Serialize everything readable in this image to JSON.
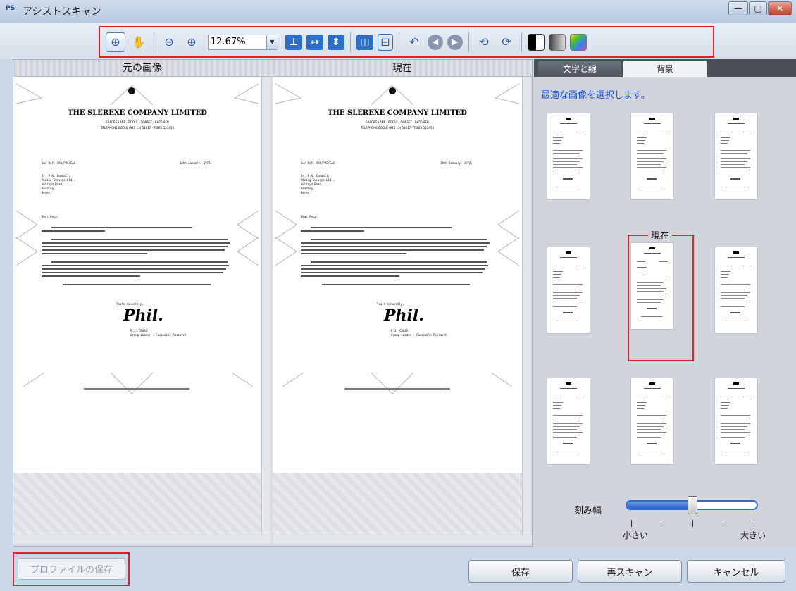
{
  "window": {
    "icon_label": "PS",
    "title": "アシストスキャン",
    "controls": [
      "—",
      "▢",
      "✕"
    ]
  },
  "toolbar": {
    "zoom_value": "12.67%"
  },
  "left": {
    "original_label": "元の画像",
    "current_label": "現在"
  },
  "document": {
    "company": "THE SLEREXE COMPANY LIMITED",
    "address_1": "SAPORS LANE · BOOLE · DORSET · BH25 8ER",
    "address_2": "TELEPHONE BOOLE (945 13) 51617 · TELEX 123456",
    "ref": "Our Ref. 350/PJC/EAC",
    "date": "18th January, 1972.",
    "recipient": [
      "Dr. P.N. Cundall,",
      "Mining Surveys Ltd.,",
      "Holroyd Road,",
      "Reading,",
      "Berks."
    ],
    "salutation": "Dear Pete,",
    "closing": "Yours sincerely,",
    "signature": "Phil.",
    "signer": [
      "P.J. CROSS",
      "Group Leader - Facsimile Research"
    ]
  },
  "right": {
    "tabs": [
      "文字と線",
      "背景"
    ],
    "choose_label": "最適な画像を選択します。",
    "current_label": "現在",
    "engrave_label": "刻み幅",
    "engrave_value": 0.5,
    "small_label": "小さい",
    "large_label": "大きい"
  },
  "buttons": {
    "profile_save": "プロファイルの保存",
    "save": "保存",
    "rescan": "再スキャン",
    "cancel": "キャンセル"
  }
}
